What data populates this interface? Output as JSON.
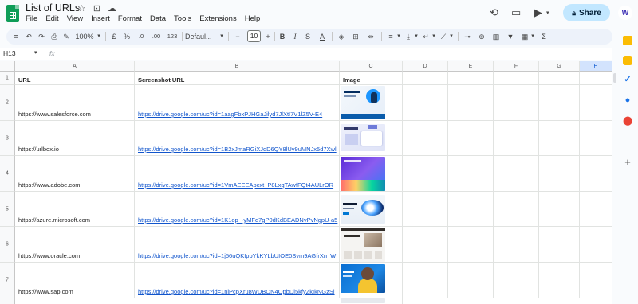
{
  "doc": {
    "title": "List of URLs",
    "menus": [
      "File",
      "Edit",
      "View",
      "Insert",
      "Format",
      "Data",
      "Tools",
      "Extensions",
      "Help"
    ]
  },
  "header_actions": {
    "share_label": "Share"
  },
  "toolbar": {
    "zoom": "100%",
    "currency": "£",
    "percent": "%",
    "decimal_decrease": ".0",
    "decimal_increase": ".00",
    "number_format": "123",
    "font_name": "Defaul...",
    "font_size": "10",
    "minus": "−",
    "plus": "+",
    "bold": "B",
    "italic": "I",
    "strike": "S",
    "text_color": "A",
    "sigma": "Σ"
  },
  "formula_bar": {
    "name_box": "H13",
    "fx": "fx"
  },
  "columns": [
    "A",
    "B",
    "C",
    "D",
    "E",
    "F",
    "G",
    "H"
  ],
  "row_numbers": [
    "1",
    "2",
    "3",
    "4",
    "5",
    "6",
    "7"
  ],
  "table": {
    "headers": [
      "URL",
      "Screenshot URL",
      "Image"
    ],
    "rows": [
      {
        "url": "https://www.salesforce.com",
        "screenshot": "https://drive.google.com/uc?id=1aagFbxPJHGaJilyd7JlXtI7V1lZ5V-E4"
      },
      {
        "url": "https://urlbox.io",
        "screenshot": "https://drive.google.com/uc?id=1B2xJmaRGiXJdD6QY8lUv9uMNJx5d7Xwl"
      },
      {
        "url": "https://www.adobe.com",
        "screenshot": "https://drive.google.com/uc?id=1VmAEEEApcxt_P8LxqTAwfFQt4AULrOR"
      },
      {
        "url": "https://azure.microsoft.com",
        "screenshot": "https://drive.google.com/uc?id=1K1op_-yMFd7gP0dKdBEADNvPvNgpU-a5"
      },
      {
        "url": "https://www.oracle.com",
        "screenshot": "https://drive.google.com/uc?id=1j56uQKIpbYkKYLbUIOE0Svm9AGfrXn_W"
      },
      {
        "url": "https://www.sap.com",
        "screenshot": "https://drive.google.com/uc?id=1nlPcpXru8WDBON4OpbDi5kfyZkIkNGzSi"
      }
    ]
  },
  "avatar_letter": "W",
  "colors": {
    "share_bg": "#c2e7ff",
    "link": "#1155cc",
    "selected_col": "#d3e3fd",
    "toolbar_bg": "#edf2fa"
  },
  "icons": [
    "history-icon",
    "comment-icon",
    "video-call-icon",
    "lock-icon",
    "star-icon",
    "move-to-folder-icon",
    "cloud-status-icon"
  ]
}
